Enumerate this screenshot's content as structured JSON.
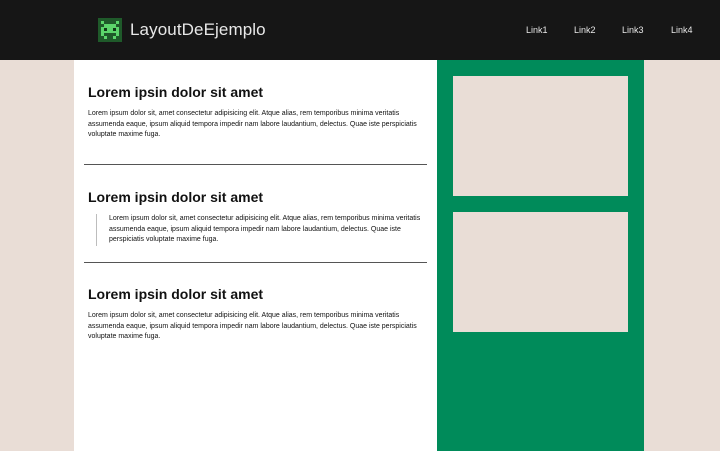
{
  "header": {
    "logo_icon": "pixel-alien-icon",
    "brand": "LayoutDeEjemplo",
    "nav": [
      "Link1",
      "Link2",
      "Link3",
      "Link4"
    ]
  },
  "content": {
    "sections": [
      {
        "title": "Lorem ipsin dolor sit amet",
        "text": "Lorem ipsum dolor sit, amet consectetur adipisicing elit. Atque alias, rem temporibus minima veritatis assumenda eaque, ipsum aliquid tempora impedir nam labore laudantium, delectus. Quae iste perspiciatis voluptate maxime fuga."
      },
      {
        "title": "Lorem ipsin dolor sit amet",
        "text": "Lorem ipsum dolor sit, amet consectetur adipisicing elit. Atque alias, rem temporibus minima veritatis assumenda eaque, ipsum aliquid tempora impedir nam labore laudantium, delectus. Quae iste perspiciatis voluptate maxime fuga."
      },
      {
        "title": "Lorem ipsin dolor sit amet",
        "text": "Lorem ipsum dolor sit, amet consectetur adipisicing elit. Atque alias, rem temporibus minima veritatis assumenda eaque, ipsum aliquid tempora impedir nam labore laudantium, delectus. Quae iste perspiciatis voluptate maxime fuga."
      }
    ]
  },
  "colors": {
    "header_bg": "#161616",
    "page_bg": "#e9ddd6",
    "sidebar_bg": "#008b5a",
    "logo_green": "#5cd66b"
  }
}
